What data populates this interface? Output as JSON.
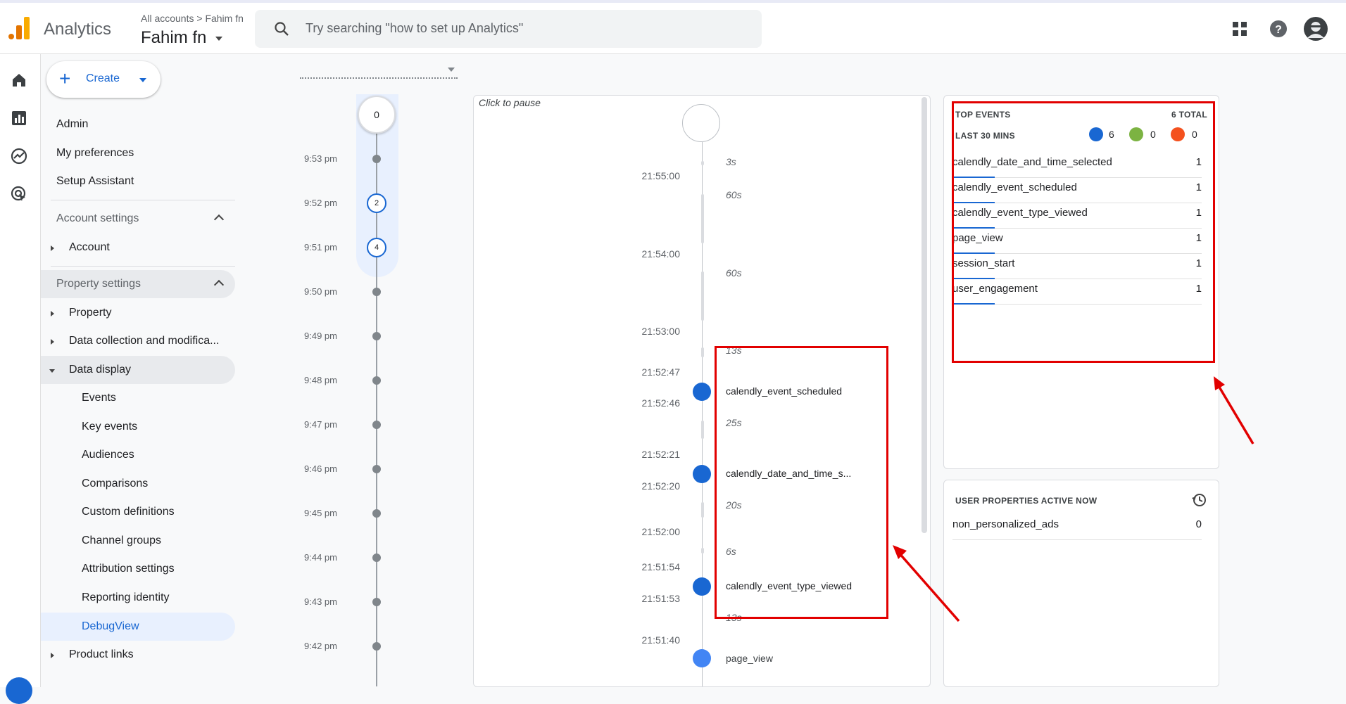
{
  "header": {
    "app_name": "Analytics",
    "breadcrumb": "All accounts > Fahim fn",
    "account_name": "Fahim fn",
    "search_placeholder": "Try searching \"how to set up Analytics\""
  },
  "sidebar": {
    "create_label": "Create",
    "items": {
      "admin": "Admin",
      "preferences": "My preferences",
      "setup": "Setup Assistant",
      "account_settings": "Account settings",
      "account": "Account",
      "property_settings": "Property settings",
      "property": "Property",
      "data_collection": "Data collection and modifica...",
      "data_display": "Data display",
      "events": "Events",
      "key_events": "Key events",
      "audiences": "Audiences",
      "comparisons": "Comparisons",
      "custom_definitions": "Custom definitions",
      "channel_groups": "Channel groups",
      "attribution": "Attribution settings",
      "reporting_identity": "Reporting identity",
      "debugview": "DebugView",
      "product_links": "Product links"
    }
  },
  "minutes": {
    "top_count": "0",
    "labels": [
      "9:53 pm",
      "9:52 pm",
      "9:51 pm",
      "9:50 pm",
      "9:49 pm",
      "9:48 pm",
      "9:47 pm",
      "9:46 pm",
      "9:45 pm",
      "9:44 pm",
      "9:43 pm",
      "9:42 pm"
    ],
    "badge_952": "2",
    "badge_951": "4"
  },
  "stream": {
    "pause_label": "Click to pause",
    "times": [
      "21:55:00",
      "21:54:00",
      "21:53:00",
      "21:52:47",
      "21:52:46",
      "21:52:21",
      "21:52:20",
      "21:52:00",
      "21:51:54",
      "21:51:53",
      "21:51:40"
    ],
    "gaps": [
      "3s",
      "60s",
      "60s",
      "13s",
      "25s",
      "20s",
      "6s",
      "13s"
    ],
    "events": [
      "calendly_event_scheduled",
      "calendly_date_and_time_s...",
      "calendly_event_type_viewed",
      "page_view"
    ]
  },
  "top_events": {
    "title": "TOP EVENTS",
    "total": "6 TOTAL",
    "period": "LAST 30 MINS",
    "count_events": "6",
    "count_key": "0",
    "count_errors": "0",
    "rows": [
      {
        "name": "calendly_date_and_time_selected",
        "count": "1"
      },
      {
        "name": "calendly_event_scheduled",
        "count": "1"
      },
      {
        "name": "calendly_event_type_viewed",
        "count": "1"
      },
      {
        "name": "page_view",
        "count": "1"
      },
      {
        "name": "session_start",
        "count": "1"
      },
      {
        "name": "user_engagement",
        "count": "1"
      }
    ]
  },
  "user_props": {
    "title": "USER PROPERTIES ACTIVE NOW",
    "rows": [
      {
        "name": "non_personalized_ads",
        "count": "0"
      }
    ]
  },
  "colors": {
    "accent": "#1967d2",
    "annotation": "#e20000",
    "logo_orange": "#f9ab00",
    "logo_dark": "#e37400"
  }
}
